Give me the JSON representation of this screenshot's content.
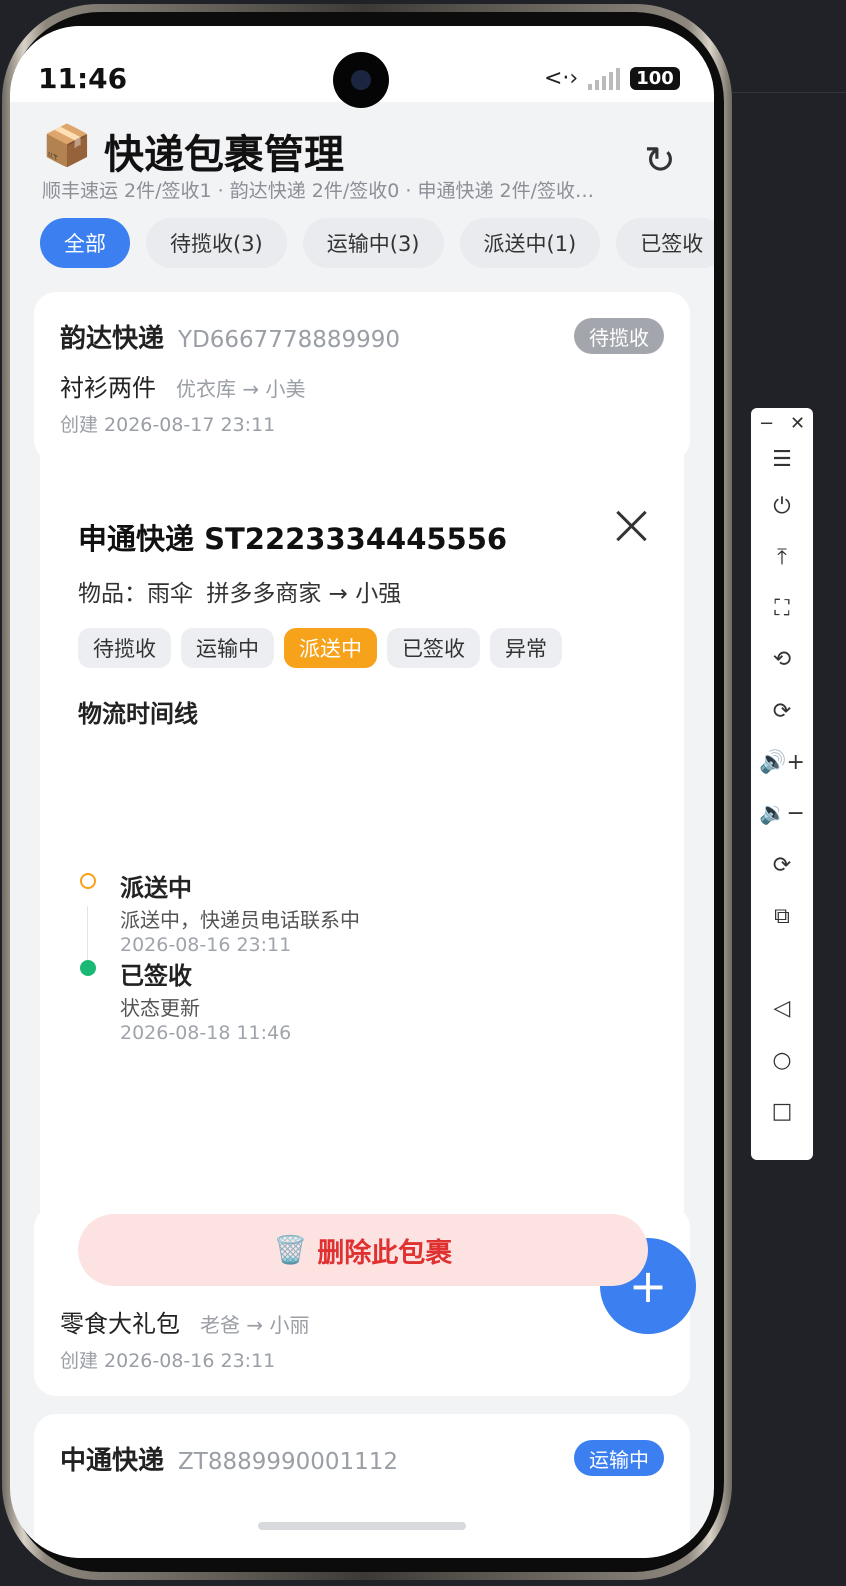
{
  "status_bar": {
    "time": "11:46",
    "network": "<·›",
    "battery": "100"
  },
  "header": {
    "icon": "📦",
    "title": "快递包裹管理",
    "summary": "顺丰速运 2件/签收1 · 韵达快递 2件/签收0 · 申通快递 2件/签收…",
    "refresh_icon": "↻"
  },
  "tabs": [
    {
      "label": "全部",
      "active": true
    },
    {
      "label": "待揽收(3)",
      "active": false
    },
    {
      "label": "运输中(3)",
      "active": false
    },
    {
      "label": "派送中(1)",
      "active": false
    },
    {
      "label": "已签收",
      "active": false
    }
  ],
  "cards": [
    {
      "carrier": "韵达快递",
      "tracking": "YD6667778889990",
      "badge": "待揽收",
      "badge_color": "#a3a7ad",
      "item": "衬衫两件",
      "route": "优衣库 → 小美",
      "created": "创建 2026-08-17 23:11"
    },
    {
      "carrier": "",
      "tracking": "",
      "badge": "",
      "item": "零食大礼包",
      "route": "老爸 → 小丽",
      "created": "创建 2026-08-16 23:11"
    },
    {
      "carrier": "中通快递",
      "tracking": "ZT8889990001112",
      "badge": "运输中",
      "badge_color": "#3b7ff0"
    }
  ],
  "detail": {
    "title": "申通快递 ST2223334445556",
    "item_label": "物品：雨伞",
    "route": "拼多多商家 → 小强",
    "statuses": [
      {
        "label": "待揽收",
        "current": false
      },
      {
        "label": "运输中",
        "current": false
      },
      {
        "label": "派送中",
        "current": true
      },
      {
        "label": "已签收",
        "current": false
      },
      {
        "label": "异常",
        "current": false
      }
    ],
    "timeline_heading": "物流时间线",
    "timeline": [
      {
        "title": "派送中",
        "desc": "派送中，快递员电话联系中",
        "time": "2026-08-16 23:11",
        "dot": "hollow",
        "color": "#f6a21a"
      },
      {
        "title": "已签收",
        "desc": "状态更新",
        "time": "2026-08-18 11:46",
        "dot": "solid",
        "color": "#1bb874"
      }
    ],
    "delete_icon": "🗑️",
    "delete_label": "删除此包裹"
  },
  "fab": {
    "label": "+"
  },
  "toolbar": {
    "minimize": "−",
    "close": "✕",
    "buttons": [
      "☰",
      "⏻",
      "⤒",
      "⛶",
      "⟲",
      "⟳",
      "🔊+",
      "🔉−",
      "⟳",
      "⧉",
      "◁",
      "○",
      "□"
    ]
  }
}
